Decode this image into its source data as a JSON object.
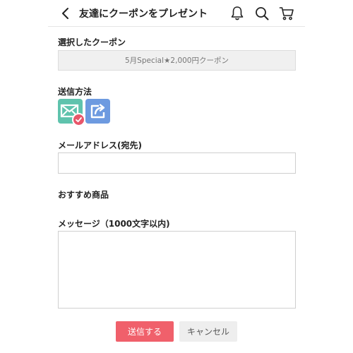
{
  "header": {
    "title": "友達にクーポンをプレゼント"
  },
  "coupon": {
    "label": "選択したクーポン",
    "value": "5月Special★2,000円クーポン"
  },
  "send_method": {
    "label": "送信方法"
  },
  "email": {
    "label": "メールアドレス(宛先)",
    "value": "",
    "placeholder": ""
  },
  "recommended": {
    "label": "おすすめ商品"
  },
  "message": {
    "label": "メッセージ（1000文字以内)",
    "value": "",
    "placeholder": ""
  },
  "actions": {
    "send_label": "送信する",
    "cancel_label": "キャンセル"
  },
  "colors": {
    "send_button": "#f0606b",
    "mail_method": "#5fc3ad",
    "share_method": "#6d9ae0",
    "check_badge": "#e8566a"
  }
}
